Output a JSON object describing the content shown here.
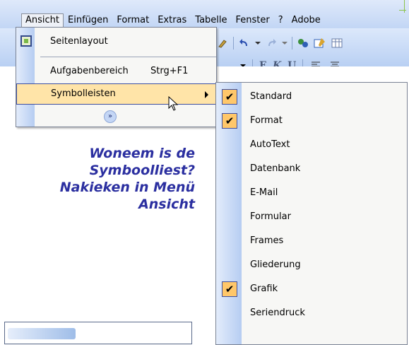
{
  "menubar": {
    "items": [
      "Ansicht",
      "Einfügen",
      "Format",
      "Extras",
      "Tabelle",
      "Fenster",
      "?",
      "Adobe"
    ]
  },
  "toolbar": {
    "format_buttons": [
      "F",
      "K",
      "U"
    ]
  },
  "ansicht_menu": {
    "items": [
      {
        "label": "Seitenlayout",
        "icon": "page-layout-icon"
      },
      {
        "label": "Aufgabenbereich",
        "shortcut": "Strg+F1"
      },
      {
        "label": "Symbolleisten",
        "highlighted": true,
        "submenu": true
      },
      {
        "label": "",
        "icon": "expand-chevrons-icon"
      }
    ]
  },
  "symbolleisten_menu": {
    "items": [
      {
        "label": "Standard",
        "checked": true
      },
      {
        "label": "Format",
        "checked": true
      },
      {
        "label": "AutoText",
        "checked": false
      },
      {
        "label": "Datenbank",
        "checked": false
      },
      {
        "label": "E-Mail",
        "checked": false
      },
      {
        "label": "Formular",
        "checked": false
      },
      {
        "label": "Frames",
        "checked": false
      },
      {
        "label": "Gliederung",
        "checked": false
      },
      {
        "label": "Grafik",
        "checked": true
      },
      {
        "label": "Seriendruck",
        "checked": false
      }
    ]
  },
  "callout": {
    "lines": [
      "Woneem is de",
      "Symboolliest?",
      "Nakieken in Menü",
      "Ansicht"
    ]
  },
  "colors": {
    "highlight": "#ffe4a8",
    "check_bg": "#ffc76a",
    "callout_text": "#2b2fa0"
  }
}
